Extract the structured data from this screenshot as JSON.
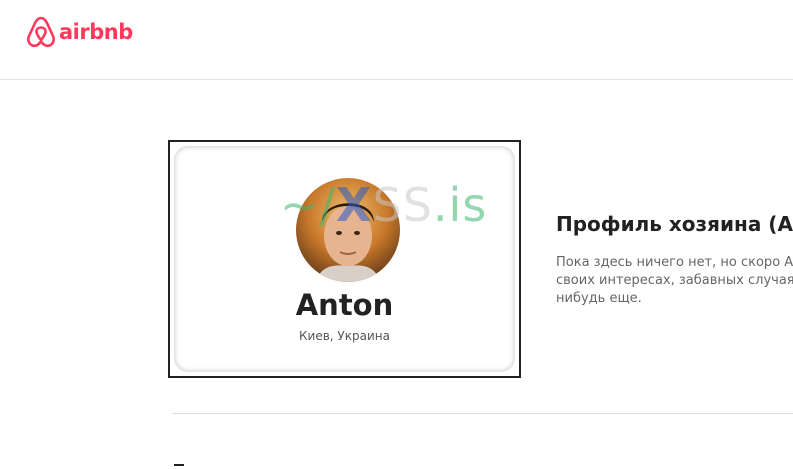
{
  "header": {
    "logo_text": "airbnb",
    "logo_icon": "airbnb-belo-icon",
    "brand_color": "#ff385c"
  },
  "profile_card": {
    "avatar_icon": "user-avatar-photo",
    "watermark": {
      "tilde": "~",
      "slash": "/",
      "x": "X",
      "mid": "SS",
      "tail": ".is"
    },
    "name": "Anton",
    "location": "Киев, Украина"
  },
  "about": {
    "title": "Профиль хозяина (Anton)",
    "bio_lines": [
      "Пока здесь ничего нет, но скоро Anton",
      "своих интересах, забавных случаях",
      "нибудь еще."
    ]
  }
}
